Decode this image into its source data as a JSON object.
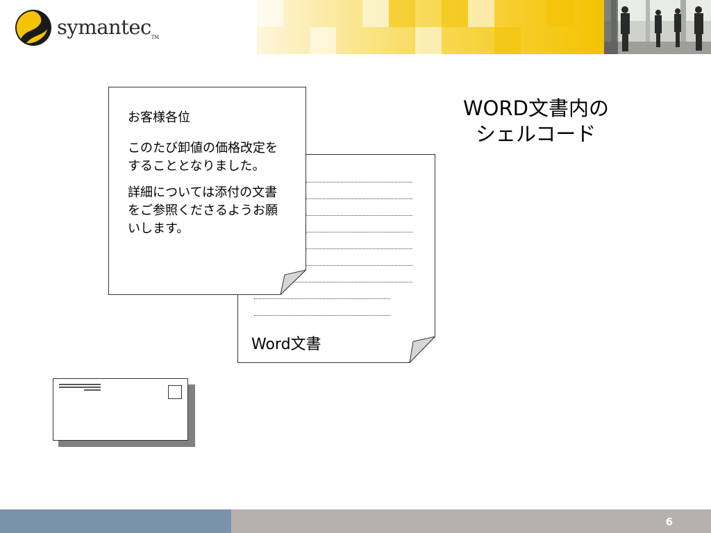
{
  "header": {
    "logo_text": "symantec",
    "logo_tm": "TM"
  },
  "title": {
    "line1": "WORD文書内の",
    "line2": "シェルコード"
  },
  "email_doc": {
    "salutation": "お客様各位",
    "paragraph1": "このたび卸値の価格改定をすることとなりました。",
    "paragraph2": "詳細については添付の文書をご参照くださるようお願いします。"
  },
  "word_doc": {
    "label": "Word文書",
    "logo_icon": "shell-logo-icon"
  },
  "footer": {
    "page_number": "6"
  },
  "colors": {
    "mosaic_yellow": "#f5c400",
    "footer_blue": "#7a93ab",
    "footer_gray": "#b5b2ae",
    "shell_olive": "#8a8a1e"
  }
}
